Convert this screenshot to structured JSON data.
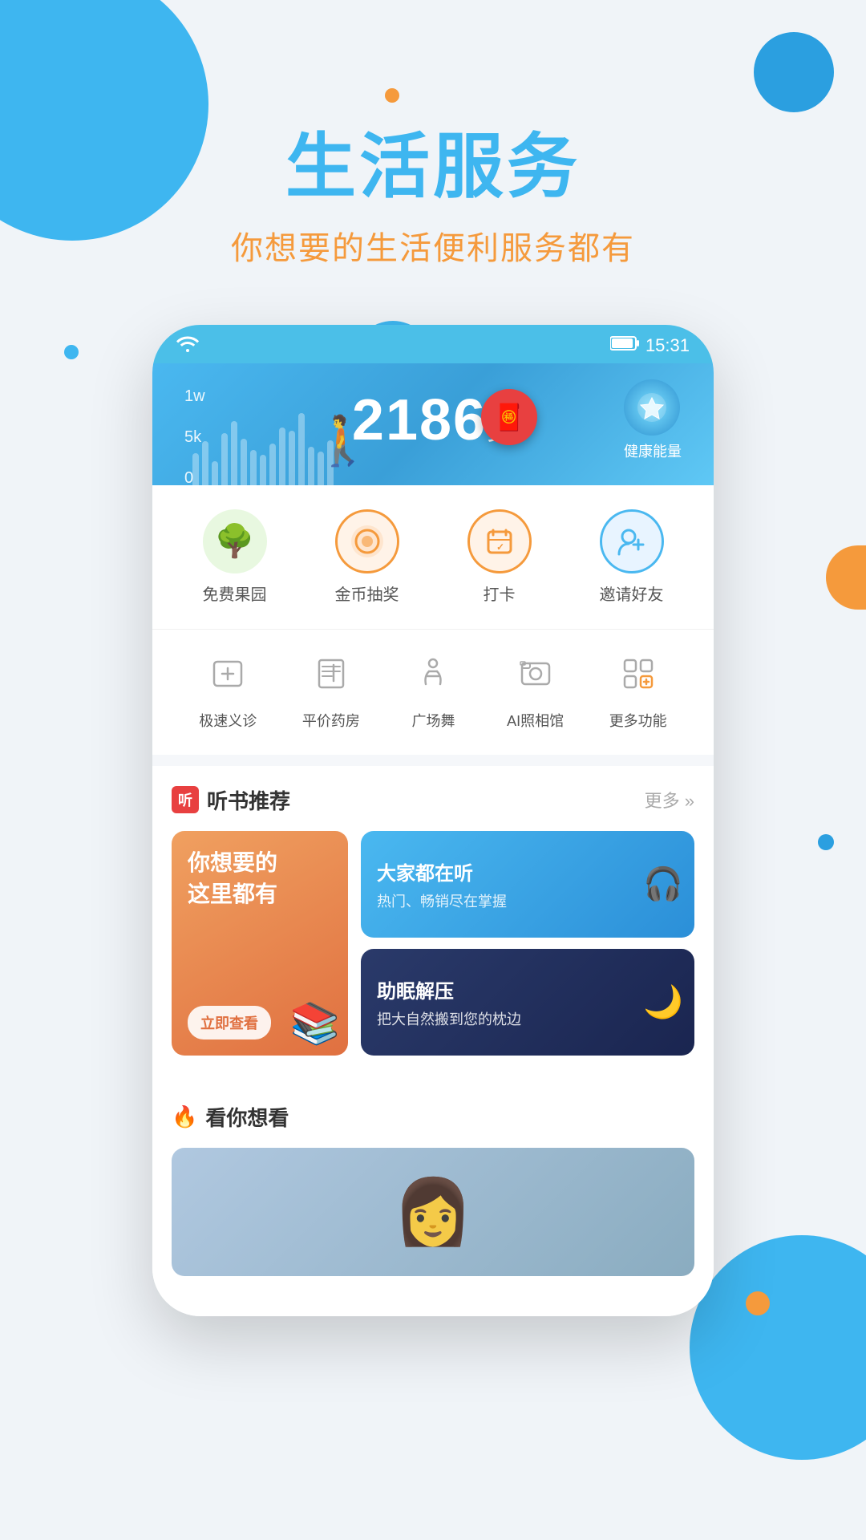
{
  "app": {
    "title": "生活服务",
    "subtitle": "你想要的生活便利服务都有"
  },
  "phone": {
    "status_bar": {
      "time": "15:31",
      "battery_icon": "🔋",
      "wifi_icon": "📶"
    },
    "step_counter": {
      "steps": "2186",
      "unit": "步",
      "label_1w": "1w",
      "label_5k": "5k",
      "label_0": "0",
      "health_label": "健康能量",
      "chart_bars": [
        30,
        45,
        20,
        60,
        80,
        55,
        40,
        35,
        50,
        70,
        65,
        90,
        45,
        38,
        55
      ]
    },
    "quick_icons": [
      {
        "id": "free-garden",
        "icon": "🌳",
        "label": "免费果园",
        "bg": "#e8f8e8"
      },
      {
        "id": "coin-lottery",
        "icon": "🩸",
        "label": "金币抽奖",
        "bg": "#fff0e8"
      },
      {
        "id": "checkin",
        "icon": "📅",
        "label": "打卡",
        "bg": "#fff0e8"
      },
      {
        "id": "invite-friends",
        "icon": "👤",
        "label": "邀请好友",
        "bg": "#e8f4ff"
      }
    ],
    "func_grid": [
      {
        "id": "fast-clinic",
        "label": "极速义诊"
      },
      {
        "id": "pharmacy",
        "label": "平价药房"
      },
      {
        "id": "square-dance",
        "label": "广场舞"
      },
      {
        "id": "ai-photo",
        "label": "AI照相馆"
      },
      {
        "id": "more",
        "label": "更多功能"
      }
    ],
    "listen_section": {
      "title": "听书推荐",
      "title_icon": "听",
      "more_label": "更多 »",
      "left_card": {
        "line1": "你想要的",
        "line2": "这里都有",
        "button": "立即查看"
      },
      "right_top": {
        "title": "大家都在听",
        "subtitle": "热门、畅销尽在掌握"
      },
      "right_bottom": {
        "title": "助眠解压",
        "subtitle": "把大自然搬到您的枕边"
      }
    },
    "watch_section": {
      "title": "看你想看"
    }
  }
}
